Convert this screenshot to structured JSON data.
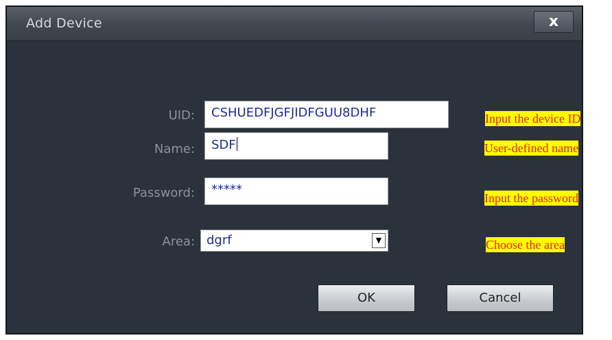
{
  "dialog": {
    "title": "Add Device",
    "close_glyph": "x",
    "close_icon": "close-icon"
  },
  "form": {
    "uid": {
      "label": "UID:",
      "value": "CSHUEDFJGFJIDFGUU8DHF"
    },
    "name": {
      "label": "Name:",
      "value": "SDF"
    },
    "password": {
      "label": "Password:",
      "value": "*****"
    },
    "area": {
      "label": "Area:",
      "value": "dgrf",
      "arrow_glyph": "▼",
      "arrow_icon": "dropdown-arrow-icon"
    }
  },
  "buttons": {
    "ok": "OK",
    "cancel": "Cancel"
  },
  "annotations": {
    "uid": "Input the device ID",
    "name": "User-defined name",
    "password": "Input the password",
    "area": "Choose the area"
  },
  "colors": {
    "dialog_bg": "#2c323b",
    "field_text": "#1d2c99",
    "annotation_text": "#e02020",
    "annotation_highlight": "#ffff00"
  }
}
